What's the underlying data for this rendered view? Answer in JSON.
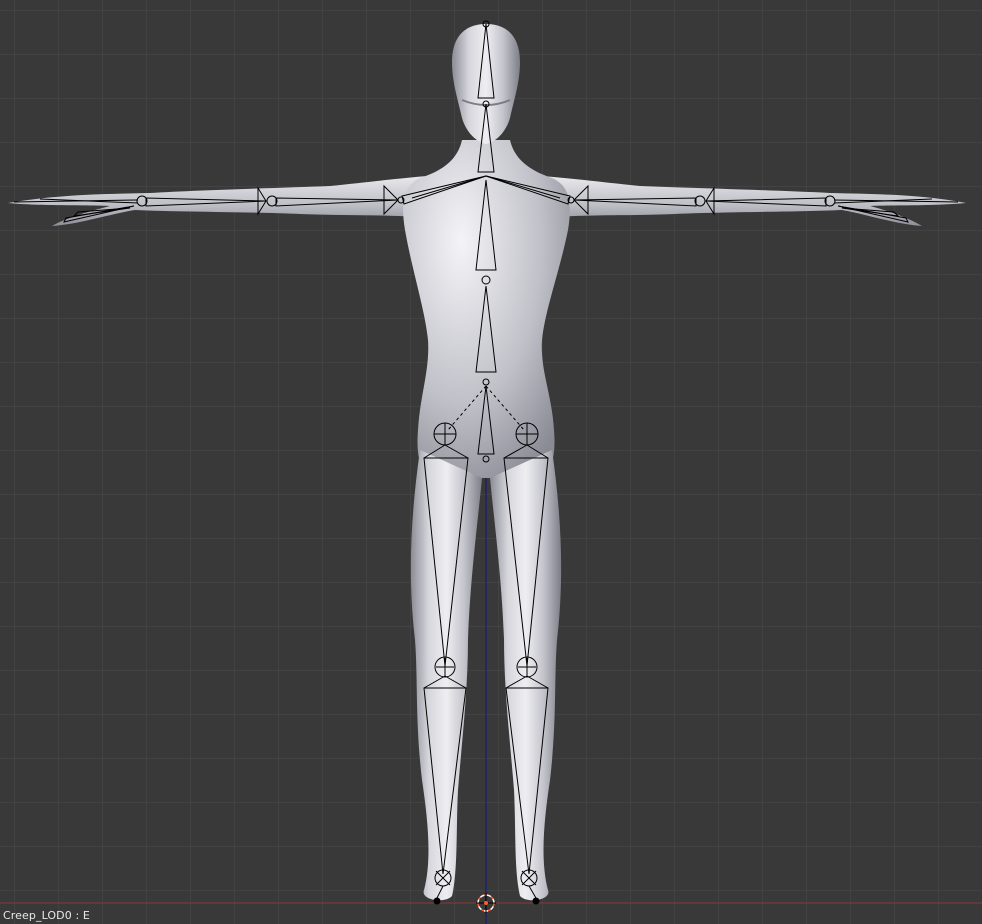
{
  "viewport": {
    "object_info": "Creep_LOD0 : E"
  },
  "colors": {
    "background": "#393939",
    "mesh": "#c9c9cf",
    "bone_wire": "#000000",
    "axis_x": "#8a3a3a",
    "axis_z": "#2a2a9a",
    "cursor": "#ff5a2a"
  },
  "icons": [
    "3d-cursor-icon"
  ]
}
